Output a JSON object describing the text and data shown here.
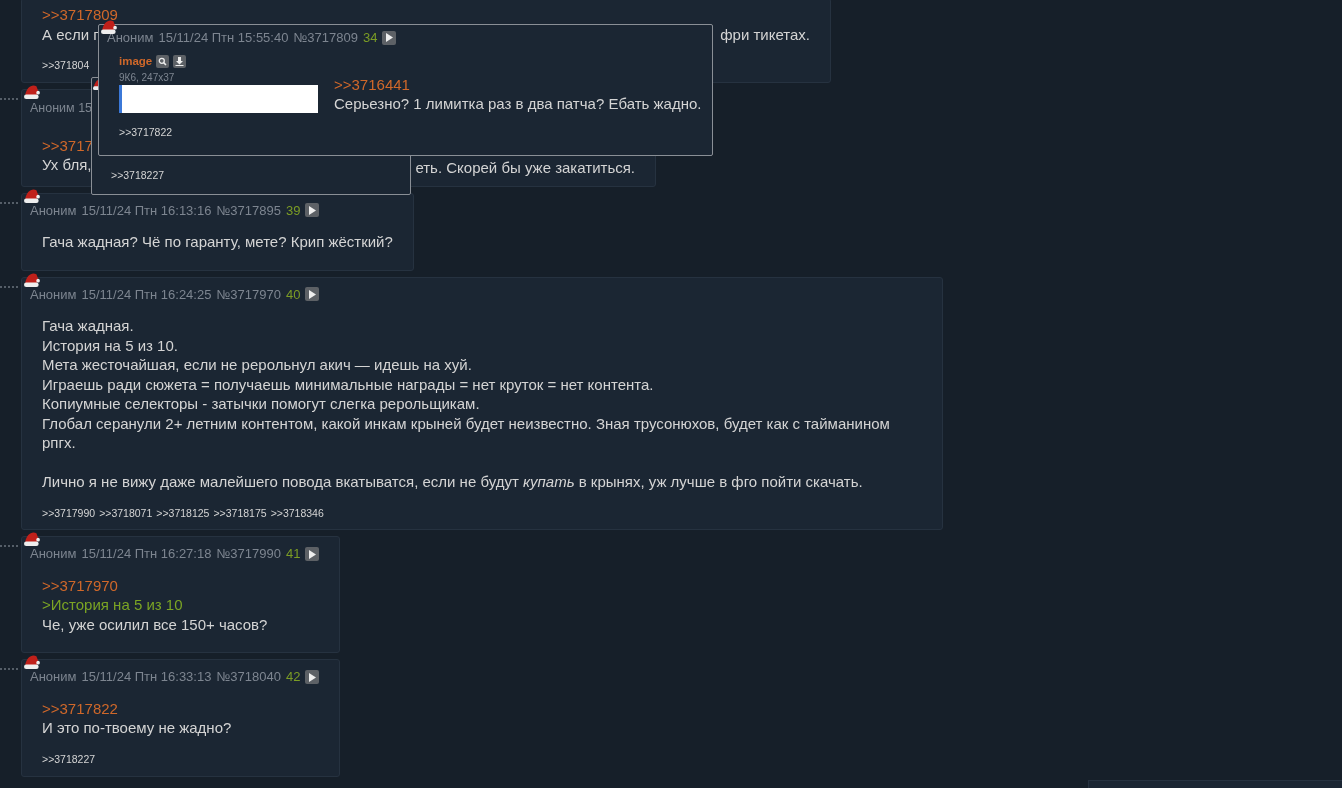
{
  "posts": [
    {
      "kind": "partial",
      "reply_link": ">>3717809",
      "text_start": "А если г",
      "text_end": "фри тикетах.",
      "backlinks": [
        ">>371804"
      ]
    },
    {
      "kind": "partial",
      "header": "Аноним 15",
      "reply_link": ">>3717",
      "text_start": "Ух бля,",
      "text_end": "еть. Скорей бы уже закатиться."
    },
    {
      "kind": "full",
      "author": "Аноним",
      "date": "15/11/24 Птн 16:13:16",
      "number": "№3717895",
      "index": "39",
      "lines": [
        {
          "kind": "text",
          "text": "Гача жадная? Чё по гаранту, мете? Крип жёсткий?"
        }
      ]
    },
    {
      "kind": "full",
      "author": "Аноним",
      "date": "15/11/24 Птн 16:24:25",
      "number": "№3717970",
      "index": "40",
      "lines": [
        {
          "kind": "text",
          "text": "Гача жадная."
        },
        {
          "kind": "text",
          "text": "История на 5 из 10."
        },
        {
          "kind": "text",
          "text": "Мета жесточайшая, если не рерольнул акич — идешь на хуй."
        },
        {
          "kind": "text",
          "text": "Играешь ради сюжета = получаешь минимальные награды = нет круток = нет контента."
        },
        {
          "kind": "text",
          "text": "Копиумные селекторы - затычки помогут слегка рерольщикам."
        },
        {
          "kind": "text",
          "text": "Глобал серанули 2+ летним контентом, какой инкам крыней будет неизвестно. Зная трусонюхов, будет как с тайманином рпгх."
        },
        {
          "kind": "blank"
        },
        {
          "kind": "text",
          "text": "Лично я не вижу даже малейшего повода вкатыватся, если не будут *купать* в крынях, уж лучше в фго пойти скачать."
        }
      ],
      "backlinks": [
        ">>3717990",
        ">>3718071",
        ">>3718125",
        ">>3718175",
        ">>3718346"
      ]
    },
    {
      "kind": "full",
      "author": "Аноним",
      "date": "15/11/24 Птн 16:27:18",
      "number": "№3717990",
      "index": "41",
      "lines": [
        {
          "kind": "link",
          "text": ">>3717970"
        },
        {
          "kind": "quote",
          "text": ">История на 5 из 10"
        },
        {
          "kind": "text",
          "text": "Че, уже осилил все 150+ часов?"
        }
      ]
    },
    {
      "kind": "full",
      "author": "Аноним",
      "date": "15/11/24 Птн 16:33:13",
      "number": "№3718040",
      "index": "42",
      "lines": [
        {
          "kind": "link",
          "text": ">>3717822"
        },
        {
          "kind": "text",
          "text": "И это по-твоему не жадно?"
        }
      ],
      "backlinks": [
        ">>3718227"
      ]
    },
    {
      "kind": "stub"
    }
  ],
  "popups": [
    {
      "kind": "full",
      "author": "Аноним",
      "date": "15/11/24 Птн 15:55:40",
      "number": "№3717809",
      "index": "34",
      "image": {
        "name": "image",
        "meta": "9К6, 247x37"
      },
      "lines": [
        {
          "kind": "link",
          "text": ">>3716441"
        },
        {
          "kind": "text",
          "text": "Серьезно? 1 лимитка раз в два патча? Ебать жадно."
        }
      ],
      "backlinks": [
        ">>3717822"
      ]
    },
    {
      "kind": "covered",
      "backlinks": [
        ">>3718227"
      ]
    }
  ]
}
